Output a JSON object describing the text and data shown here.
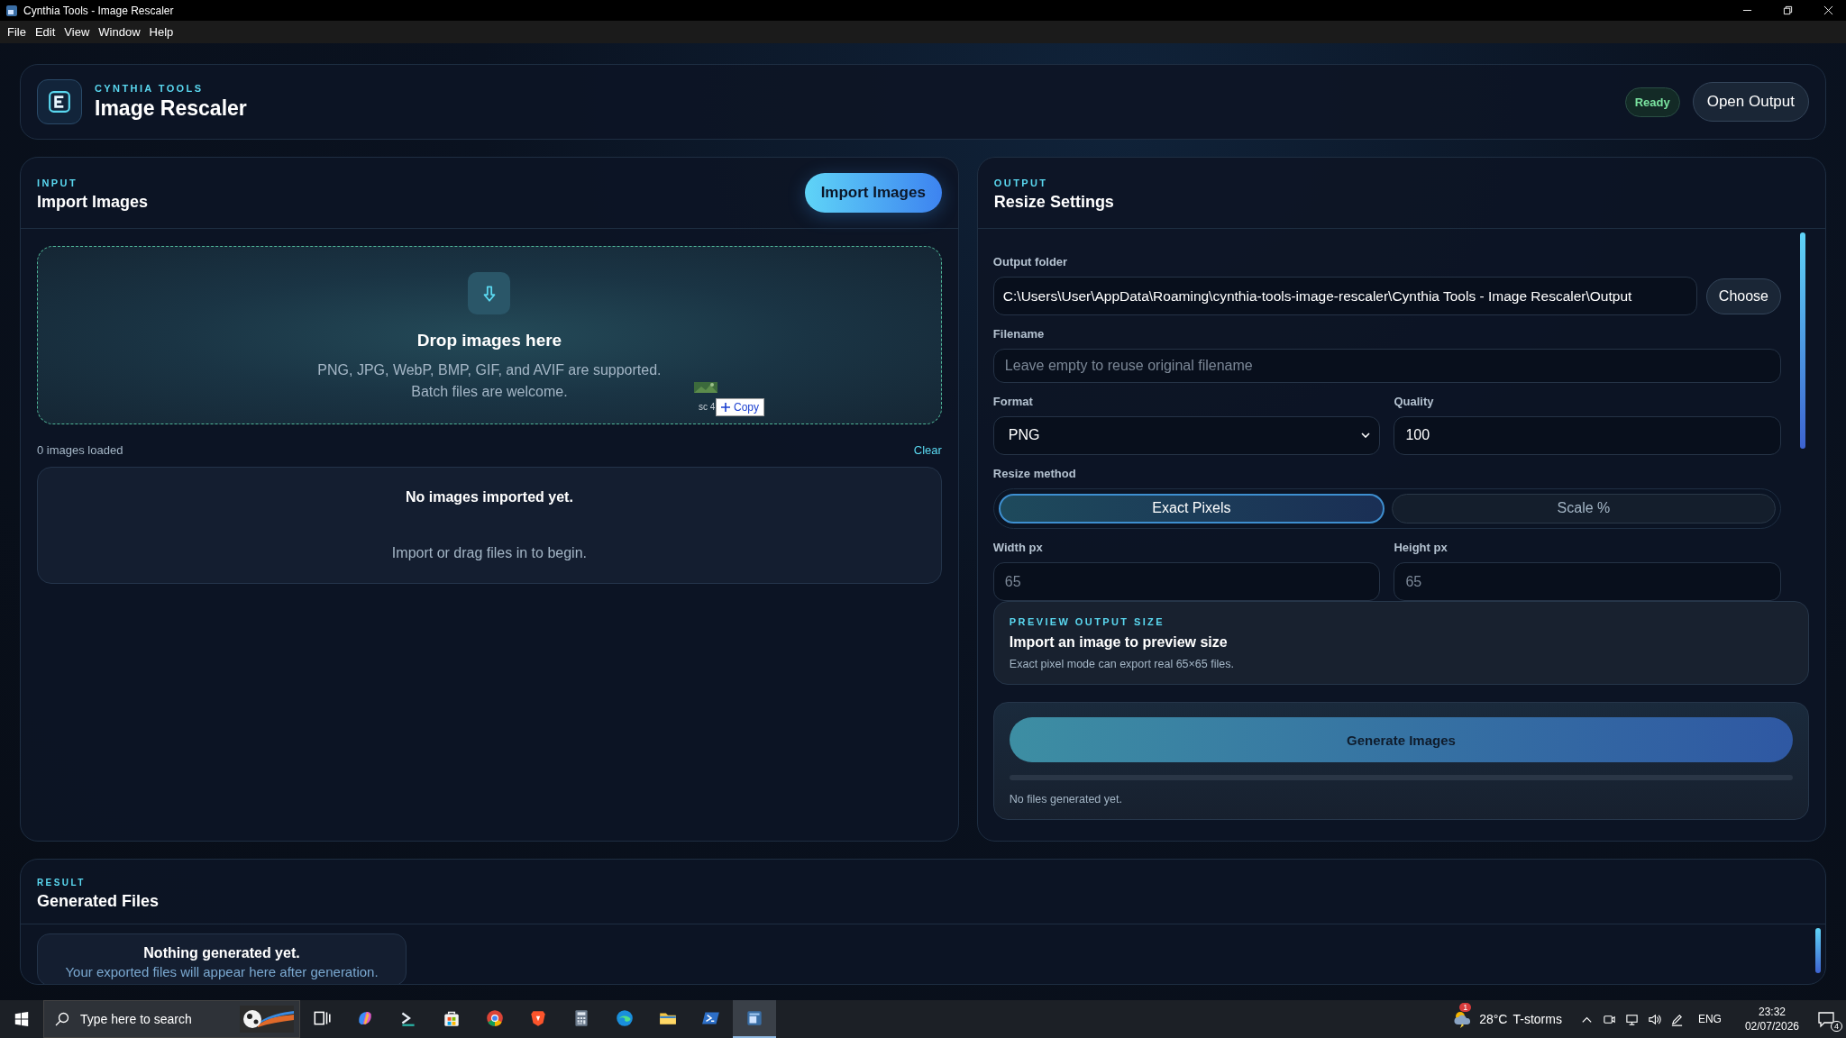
{
  "window": {
    "title": "Cynthia Tools - Image Rescaler"
  },
  "menu": [
    "File",
    "Edit",
    "View",
    "Window",
    "Help"
  ],
  "header": {
    "kicker": "CYNTHIA TOOLS",
    "title": "Image Rescaler",
    "status": "Ready",
    "open_button": "Open Output"
  },
  "input": {
    "kicker": "INPUT",
    "title": "Import Images",
    "import_button": "Import Images",
    "drop_title": "Drop images here",
    "drop_text": "PNG, JPG, WebP, BMP, GIF, and AVIF are supported. Batch files are welcome.",
    "count": "0 images loaded",
    "clear": "Clear",
    "empty_title": "No images imported yet.",
    "empty_text": "Import or drag files in to begin."
  },
  "copy_tooltip": {
    "prefix": "sc 4",
    "label": "Copy"
  },
  "output": {
    "kicker": "OUTPUT",
    "title": "Resize Settings",
    "output_folder": {
      "label": "Output folder",
      "value": "C:\\Users\\User\\AppData\\Roaming\\cynthia-tools-image-rescaler\\Cynthia Tools - Image Rescaler\\Output",
      "button": "Choose"
    },
    "filename": {
      "label": "Filename",
      "placeholder": "Leave empty to reuse original filename"
    },
    "format": {
      "label": "Format",
      "value": "PNG"
    },
    "quality": {
      "label": "Quality",
      "value": "100"
    },
    "resize_method": {
      "label": "Resize method",
      "options": [
        {
          "label": "Exact Pixels",
          "selected": true
        },
        {
          "label": "Scale %",
          "selected": false
        }
      ]
    },
    "width": {
      "label": "Width px",
      "placeholder": "65"
    },
    "height": {
      "label": "Height px",
      "placeholder": "65"
    },
    "preview": {
      "kicker": "PREVIEW OUTPUT SIZE",
      "title": "Import an image to preview size",
      "text": "Exact pixel mode can export real 65×65 files."
    },
    "generate": {
      "button": "Generate Images",
      "level": 0,
      "status": "No files generated yet."
    }
  },
  "result": {
    "kicker": "RESULT",
    "title": "Generated Files",
    "empty_title": "Nothing generated yet.",
    "empty_text": "Your exported files will appear here after generation."
  },
  "taskbar": {
    "search_placeholder": "Type here to search",
    "apps": [
      {
        "kind": "task-view",
        "selected": false
      },
      {
        "kind": "copilot",
        "selected": false
      },
      {
        "kind": "terminal",
        "selected": false
      },
      {
        "kind": "store",
        "selected": false
      },
      {
        "kind": "chrome",
        "selected": false
      },
      {
        "kind": "brave",
        "selected": false
      },
      {
        "kind": "calculator",
        "selected": false
      },
      {
        "kind": "edge",
        "selected": false
      },
      {
        "kind": "folder",
        "selected": false
      },
      {
        "kind": "powershell",
        "selected": false
      },
      {
        "kind": "rescaler",
        "selected": true
      }
    ],
    "weather": {
      "badge": "1",
      "temp": "28°C",
      "text": "T-storms"
    },
    "language": "ENG",
    "time": "23:32",
    "date": "02/07/2026",
    "notifications": "4"
  }
}
